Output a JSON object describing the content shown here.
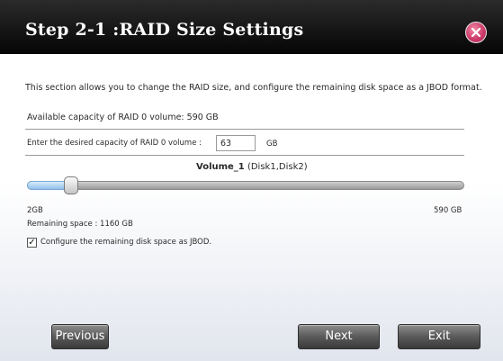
{
  "dialog": {
    "title": "Step 2-1 :RAID Size Settings",
    "description": "This section allows you to change the RAID size, and configure the remaining disk space as a JBOD format.",
    "available_capacity": "Available capacity of RAID 0 volume: 590 GB",
    "capacity_label": "Enter the desired capacity of RAID 0 volume :",
    "capacity_value": "63",
    "capacity_unit": "GB",
    "volume_name": "Volume_1",
    "volume_disks": " (Disk1,Disk2)",
    "slider": {
      "min_label": "2GB",
      "max_label": "590 GB",
      "value_fraction": 0.1
    },
    "remaining_space": "Remaining space : 1160 GB",
    "jbod_label": "Configure the remaining disk space as JBOD.",
    "jbod_checked": true
  },
  "buttons": {
    "previous": "Previous",
    "next": "Next",
    "exit": "Exit"
  },
  "colors": {
    "titlebar": "#050505",
    "close_button": "#cc3c6a",
    "slider_fill": "#8fc0ea"
  },
  "icons": {
    "close": "close-icon",
    "check": "check-icon"
  }
}
